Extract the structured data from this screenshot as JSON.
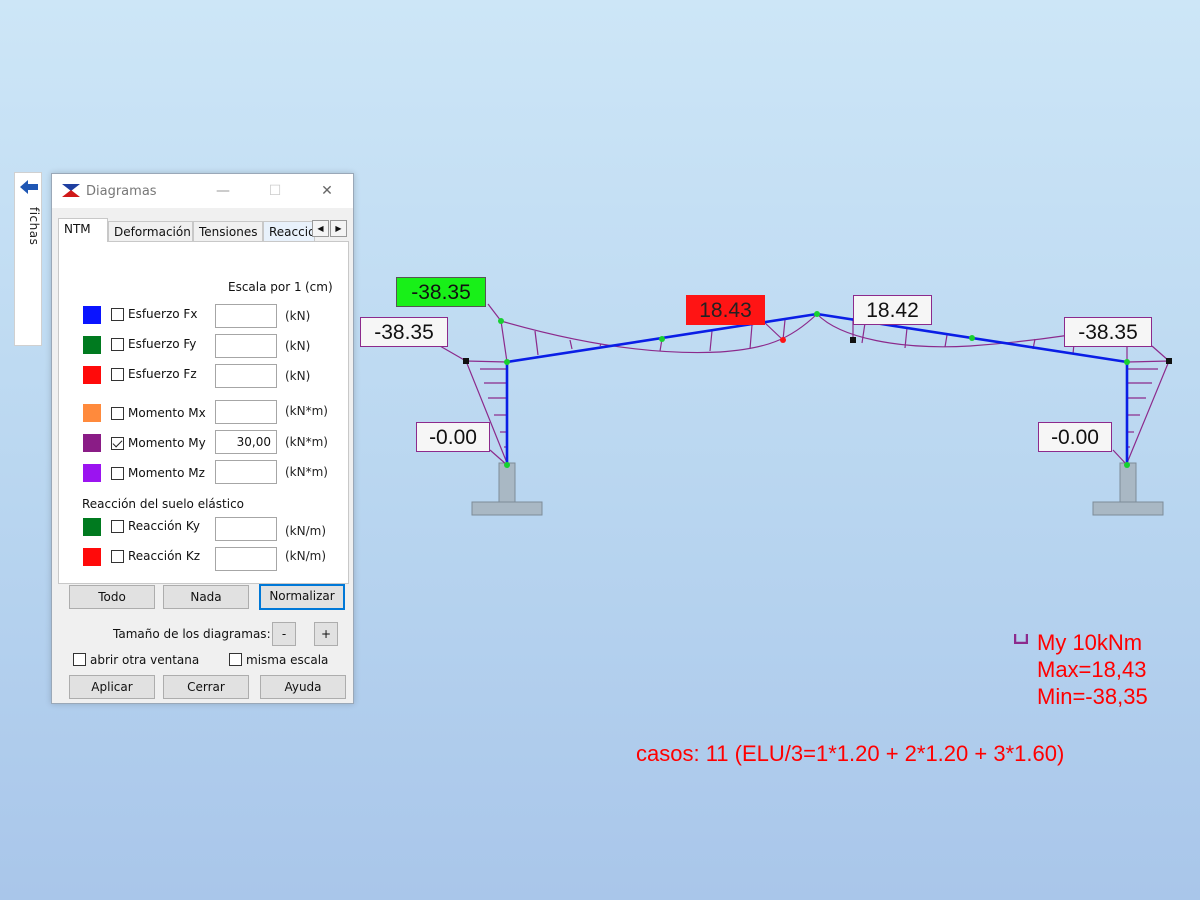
{
  "fichas": {
    "label": "fichas"
  },
  "dialog": {
    "title": "Diagramas",
    "window_buttons": {
      "minimize": "—",
      "maximize": "☐",
      "close": "✕"
    },
    "tabs": [
      "NTM",
      "Deformación",
      "Tensiones",
      "Reaccio"
    ],
    "scale_label": "Escala por 1",
    "scale_unit": "(cm)",
    "rows": [
      {
        "color": "#0a14ff",
        "label": "Esfuerzo Fx",
        "checked": false,
        "value": "",
        "unit": "(kN)"
      },
      {
        "color": "#007a1f",
        "label": "Esfuerzo Fy",
        "checked": false,
        "value": "",
        "unit": "(kN)"
      },
      {
        "color": "#ff0a0a",
        "label": "Esfuerzo Fz",
        "checked": false,
        "value": "",
        "unit": "(kN)"
      },
      {
        "color": "#ff8a3c",
        "label": "Momento Mx",
        "checked": false,
        "value": "",
        "unit": "(kN*m)"
      },
      {
        "color": "#8a1c86",
        "label": "Momento My",
        "checked": true,
        "value": "30,00",
        "unit": "(kN*m)"
      },
      {
        "color": "#9b14f0",
        "label": "Momento Mz",
        "checked": false,
        "value": "",
        "unit": "(kN*m)"
      }
    ],
    "soil_section_label": "Reacción del suelo elástico",
    "soil_rows": [
      {
        "color": "#007a1f",
        "label": "Reacción Ky",
        "checked": false,
        "value": "",
        "unit": "(kN/m)"
      },
      {
        "color": "#ff0a0a",
        "label": "Reacción Kz",
        "checked": false,
        "value": "",
        "unit": "(kN/m)"
      }
    ],
    "buttons": {
      "todo": "Todo",
      "nada": "Nada",
      "normalizar": "Normalizar"
    },
    "size_label": "Tamaño de los diagramas:",
    "size_minus": "-",
    "size_plus": "+",
    "open_other_window": "abrir otra ventana",
    "same_scale": "misma escala",
    "bottom_buttons": {
      "apply": "Aplicar",
      "close": "Cerrar",
      "help": "Ayuda"
    }
  },
  "diagram": {
    "value_labels": {
      "top_left_highlight": "-38.35",
      "left_knee": "-38.35",
      "ridge_max": "18.43",
      "ridge_right": "18.42",
      "right_knee": "-38.35",
      "left_base": "-0.00",
      "right_base": "-0.00"
    },
    "colors": {
      "frame": "#0a1ee6",
      "moment": "#8c2a8c",
      "max_bg": "#ff1414",
      "min_bg": "#18f018"
    },
    "legend": {
      "line1": "My  10kNm",
      "line2": "Max=18,43",
      "line3": "Min=-38,35"
    },
    "casos": "casos: 11 (ELU/3=1*1.20 + 2*1.20 + 3*1.60)"
  }
}
